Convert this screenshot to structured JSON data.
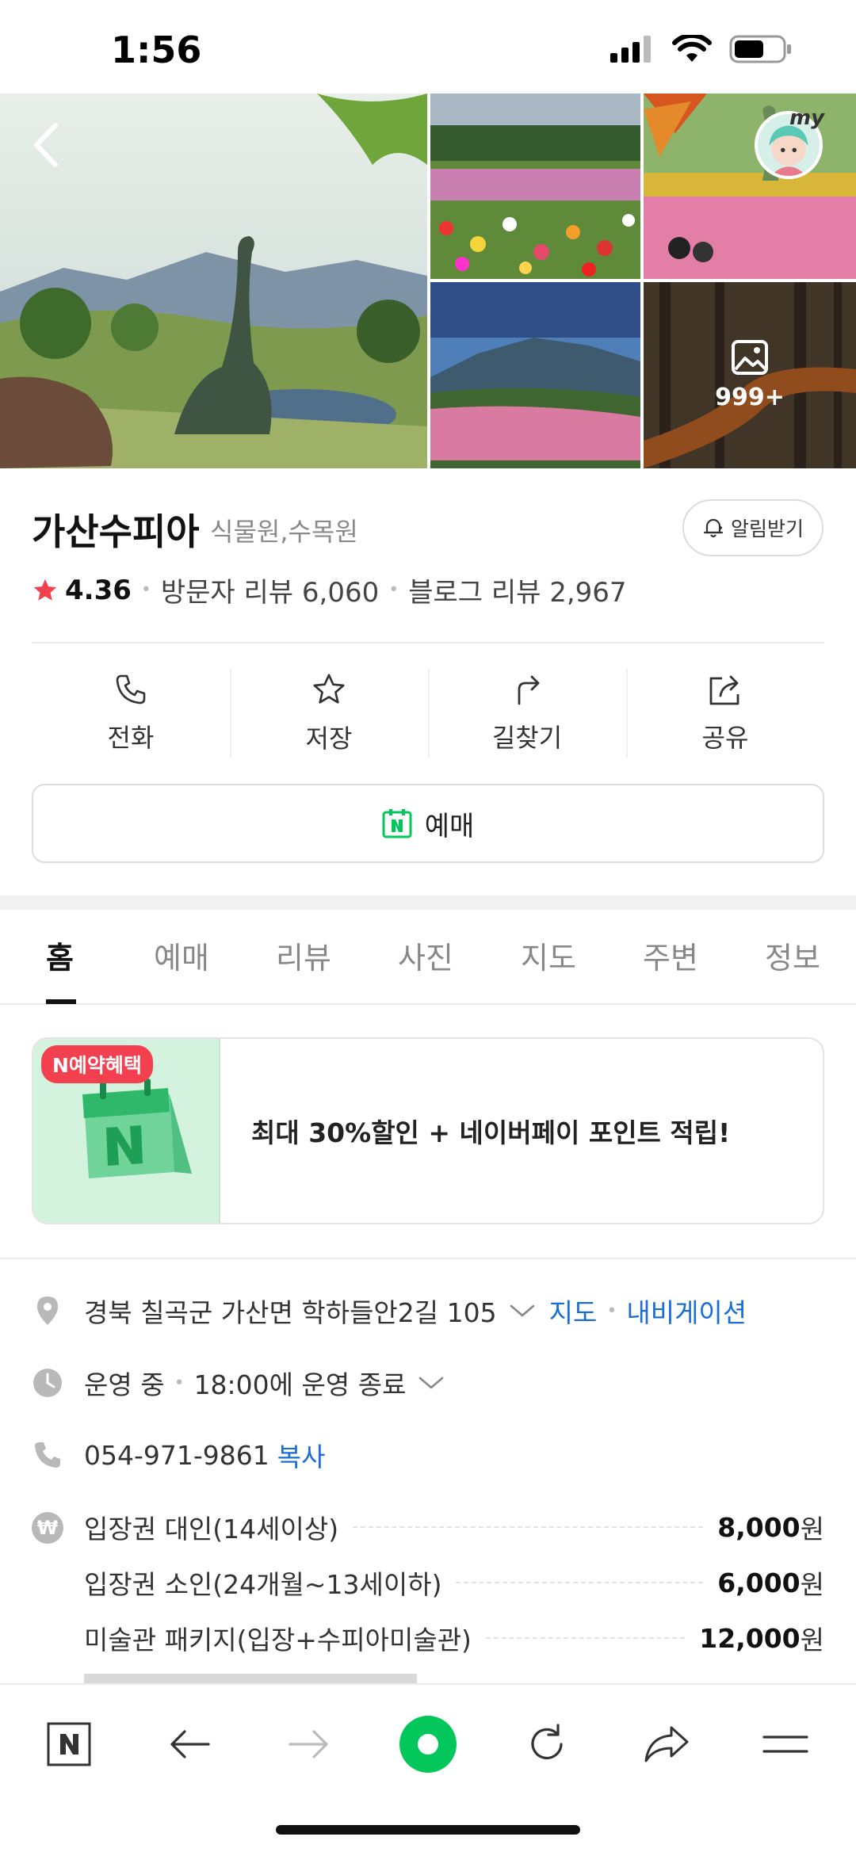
{
  "status_bar": {
    "time": "1:56"
  },
  "gallery": {
    "more_count": "999+",
    "my_label": "my"
  },
  "place": {
    "name": "가산수피아",
    "category": "식물원,수목원",
    "alarm_label": "알림받기",
    "rating": "4.36",
    "visitor_reviews": "방문자 리뷰 6,060",
    "blog_reviews": "블로그 리뷰 2,967"
  },
  "actions": [
    {
      "label": "전화",
      "icon": "phone-icon"
    },
    {
      "label": "저장",
      "icon": "star-icon"
    },
    {
      "label": "길찾기",
      "icon": "directions-icon"
    },
    {
      "label": "공유",
      "icon": "share-icon"
    }
  ],
  "reserve_label": "예매",
  "tabs": [
    "홈",
    "예매",
    "리뷰",
    "사진",
    "지도",
    "주변",
    "정보"
  ],
  "promo": {
    "badge": "N예약혜택",
    "text": "최대 30%할인 + 네이버페이 포인트 적립!"
  },
  "info": {
    "address": "경북 칠곡군 가산면 학하들안2길 105",
    "map_link": "지도",
    "navigation_link": "내비게이션",
    "hours_status": "운영 중",
    "hours_detail": "18:00에 운영 종료",
    "phone": "054-971-9861",
    "copy_label": "복사",
    "prices": [
      {
        "name": "입장권 대인(14세이상)",
        "amount": "8,000",
        "unit": "원"
      },
      {
        "name": "입장권 소인(24개월~13세이하)",
        "amount": "6,000",
        "unit": "원"
      },
      {
        "name": "미술관 패키지(입장+수피아미술관)",
        "amount": "12,000",
        "unit": "원"
      }
    ]
  },
  "colors": {
    "accent_green": "#03c75a",
    "link_blue": "#1a6dd4",
    "star_red": "#f2404f"
  }
}
